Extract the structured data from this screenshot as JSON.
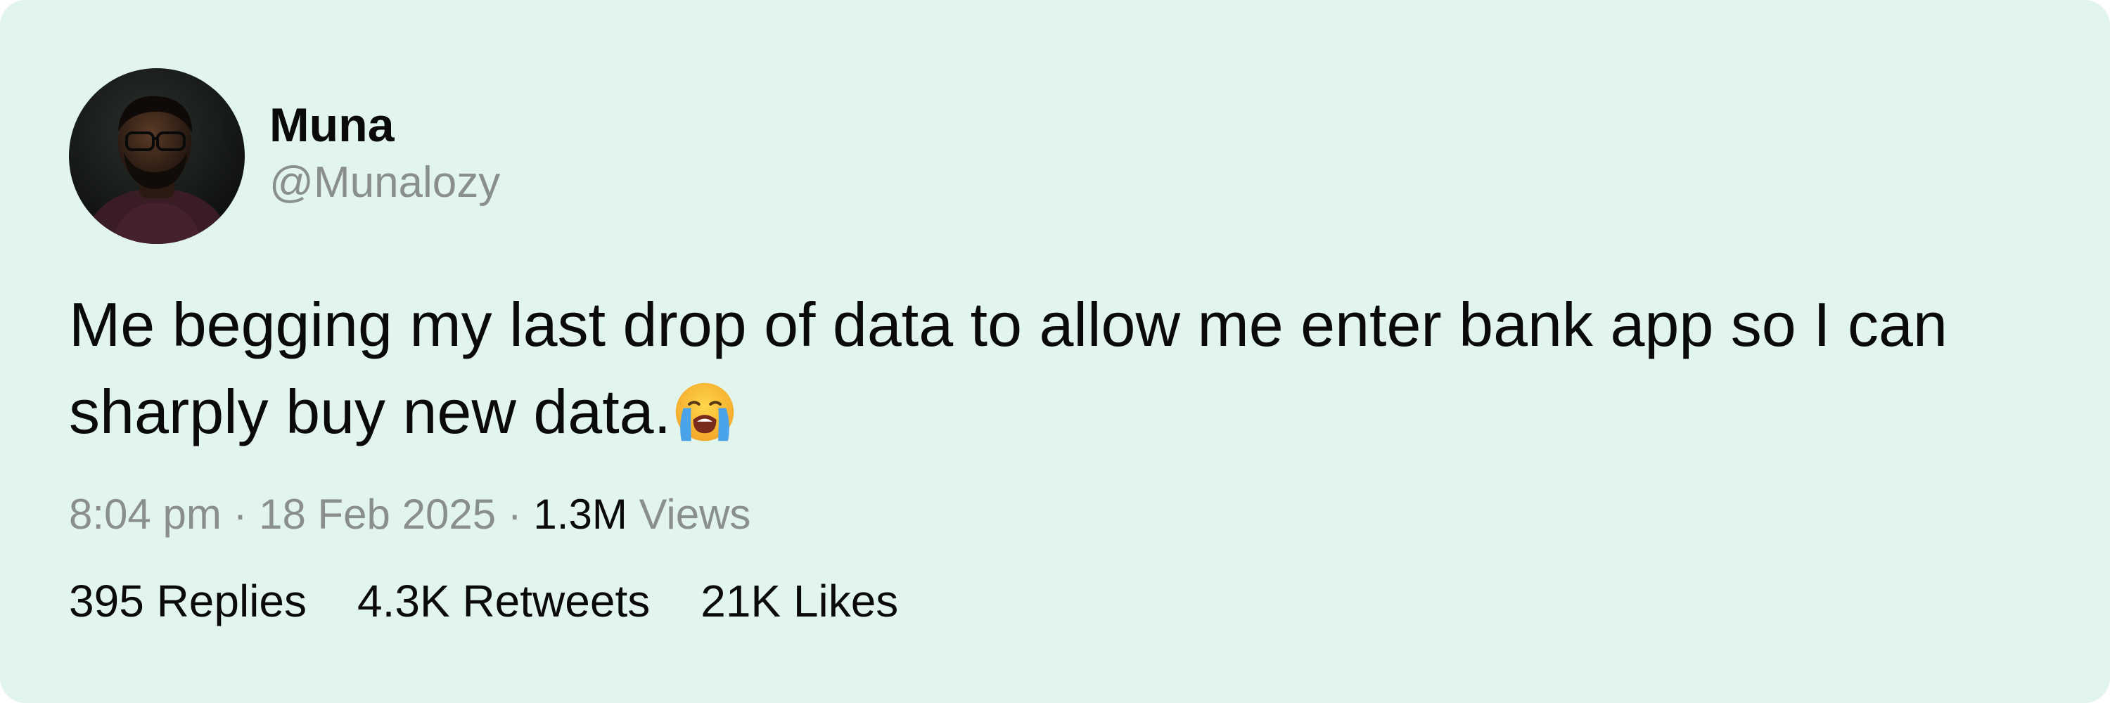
{
  "tweet": {
    "author": {
      "display_name": "Muna",
      "handle": "@Munalozy",
      "avatar_icon": "profile-photo"
    },
    "text": "Me begging my last drop of data to allow me enter bank app so I can sharply buy new data.",
    "emoji_icon": "loudly-crying-face-icon",
    "time": "8:04 pm",
    "separator": "·",
    "date": "18 Feb 2025",
    "views_count": "1.3M",
    "views_label": "Views",
    "stats": {
      "replies": "395 Replies",
      "retweets": "4.3K Retweets",
      "likes": "21K Likes"
    }
  },
  "colors": {
    "card_background": "#e2f5ed",
    "primary_text": "#0a0a0a",
    "secondary_text": "#8a8f8d"
  }
}
